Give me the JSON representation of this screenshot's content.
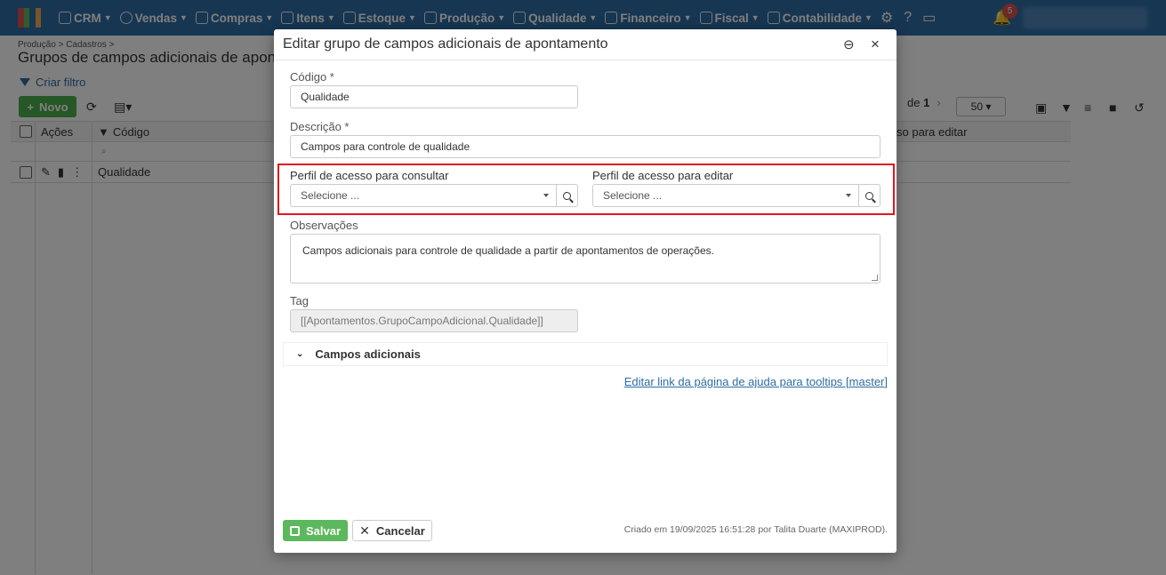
{
  "nav": {
    "items": [
      {
        "label": "CRM",
        "icon": "crm-icon"
      },
      {
        "label": "Vendas",
        "icon": "dollar-icon"
      },
      {
        "label": "Compras",
        "icon": "cart-icon"
      },
      {
        "label": "Itens",
        "icon": "items-icon"
      },
      {
        "label": "Estoque",
        "icon": "stock-icon"
      },
      {
        "label": "Produção",
        "icon": "factory-icon"
      },
      {
        "label": "Qualidade",
        "icon": "quality-icon"
      },
      {
        "label": "Financeiro",
        "icon": "money-icon"
      },
      {
        "label": "Fiscal",
        "icon": "fiscal-icon"
      },
      {
        "label": "Contabilidade",
        "icon": "calculator-icon"
      }
    ],
    "notification_count": "5",
    "logo_colors": [
      "#d9534f",
      "#5cb85c",
      "#2e6da4",
      "#f0ad4e"
    ]
  },
  "page": {
    "breadcrumb": "Produção > Cadastros >",
    "title": "Grupos de campos adicionais de apontamento",
    "filter_link": "Criar filtro",
    "new_button": "Novo",
    "pager_of": "de",
    "pager_total": "1",
    "page_size": "50",
    "columns": {
      "actions": "Ações",
      "code": "Código",
      "edit_profile_partial": "so para editar"
    },
    "rows": [
      {
        "code": "Qualidade"
      }
    ]
  },
  "modal": {
    "title": "Editar grupo de campos adicionais de apontamento",
    "codigo_label": "Código *",
    "codigo_value": "Qualidade",
    "descricao_label": "Descrição *",
    "descricao_value": "Campos para controle de qualidade",
    "perfil_consultar_label": "Perfil de acesso para consultar",
    "perfil_consultar_value": "Selecione ...",
    "perfil_editar_label": "Perfil de acesso para editar",
    "perfil_editar_value": "Selecione ...",
    "observacoes_label": "Observações",
    "observacoes_value": "Campos adicionais para controle de qualidade a partir de apontamentos de operações.",
    "tag_label": "Tag",
    "tag_value": "[[Apontamentos.GrupoCampoAdicional.Qualidade]]",
    "section_label": "Campos adicionais",
    "help_link": "Editar link da página de ajuda para tooltips [master]",
    "save_label": "Salvar",
    "cancel_label": "Cancelar",
    "created_text": "Criado em 19/09/2025 16:51:28 por Talita Duarte (MAXIPROD).",
    "highlight_color": "#e0161c"
  }
}
